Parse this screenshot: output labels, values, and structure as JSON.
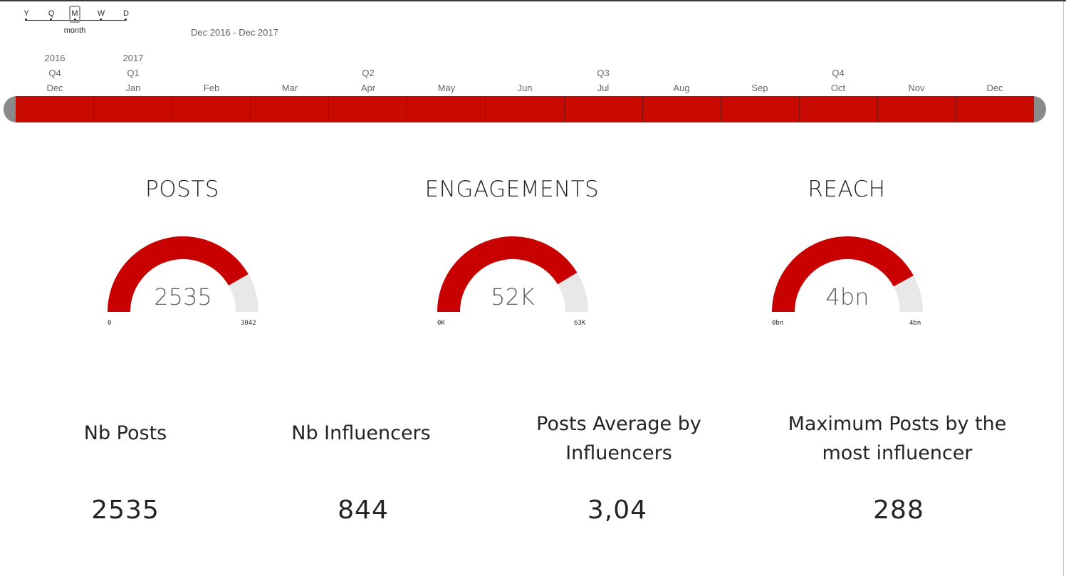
{
  "slicer": {
    "granularity_options": [
      "Y",
      "Q",
      "M",
      "W",
      "D"
    ],
    "selected_granularity": "M",
    "granularity_caption": "month",
    "date_range": "Dec 2016 - Dec 2017",
    "years": [
      "2016",
      "2017"
    ],
    "quarters": [
      "Q4",
      "Q1",
      "Q2",
      "Q3",
      "Q4"
    ],
    "months": [
      "Dec",
      "Jan",
      "Feb",
      "Mar",
      "Apr",
      "May",
      "Jun",
      "Jul",
      "Aug",
      "Sep",
      "Oct",
      "Nov",
      "Dec"
    ],
    "bar_color": "#c80a00",
    "handle_color": "#8a8a8a"
  },
  "gauges": [
    {
      "title": "POSTS",
      "value_label": "2535",
      "value": 2535,
      "min_label": "0",
      "max_label": "3042",
      "min": 0,
      "max": 3042
    },
    {
      "title": "ENGAGEMENTS",
      "value_label": "52K",
      "value": 52,
      "min_label": "0K",
      "max_label": "63K",
      "min": 0,
      "max": 63
    },
    {
      "title": "REACH",
      "value_label": "4bn",
      "value": 0.84,
      "min_label": "0bn",
      "max_label": "4bn",
      "min": 0,
      "max": 1
    }
  ],
  "gauge_colors": {
    "fill": "#c80000",
    "track": "#e8e8e8"
  },
  "cards": [
    {
      "label": "Nb Posts",
      "value": "2535"
    },
    {
      "label": "Nb Influencers",
      "value": "844"
    },
    {
      "label": "Posts Average by Influencers",
      "value": "3,04"
    },
    {
      "label": "Maximum Posts by the most influencer",
      "value": "288"
    }
  ]
}
